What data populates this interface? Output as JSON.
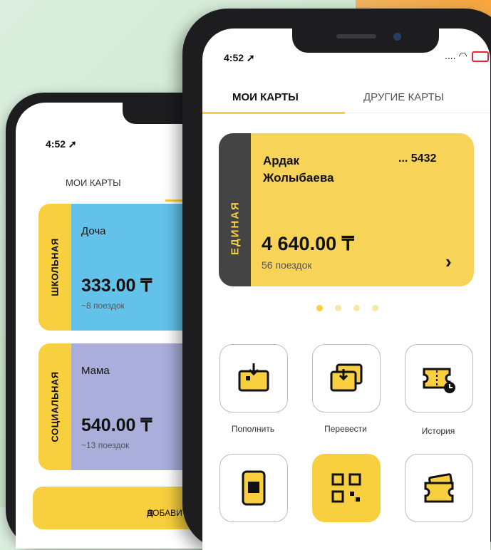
{
  "back_phone": {
    "time": "4:52",
    "tab_my_cards": "МОИ КАРТЫ",
    "cards": [
      {
        "type": "ШКОЛЬНАЯ",
        "name": "Доча",
        "balance": "333.00 ₸",
        "rides": "~8 поездок",
        "color": "#62c2ea"
      },
      {
        "type": "СОЦИАЛЬНАЯ",
        "name": "Мама",
        "balance": "540.00 ₸",
        "rides": "~13 поездок",
        "color": "#a9aedb"
      }
    ],
    "add_button": "ДОБАВИТЬ К"
  },
  "front_phone": {
    "time": "4:52",
    "status_icons": [
      "signal-icon",
      "wifi-icon",
      "battery-icon"
    ],
    "tabs": {
      "my_cards": "МОИ КАРТЫ",
      "other_cards": "ДРУГИЕ КАРТЫ"
    },
    "card": {
      "type": "ЕДИНАЯ",
      "holder": "Ардак Жолыбаева",
      "number": "... 5432",
      "balance": "4 640.00 ₸",
      "rides": "56 поездок"
    },
    "pager": {
      "count": 4,
      "active": 1
    },
    "actions": [
      {
        "label": "Пополнить",
        "icon": "top-up-icon"
      },
      {
        "label": "Перевести",
        "icon": "transfer-icon"
      },
      {
        "label": "История",
        "icon": "history-icon"
      },
      {
        "label": "",
        "icon": "phone-payment-icon"
      },
      {
        "label": "",
        "icon": "qr-code-icon"
      },
      {
        "label": "",
        "icon": "ticket-icon"
      }
    ]
  },
  "colors": {
    "accent": "#f7cf3f",
    "dark": "#444444"
  }
}
